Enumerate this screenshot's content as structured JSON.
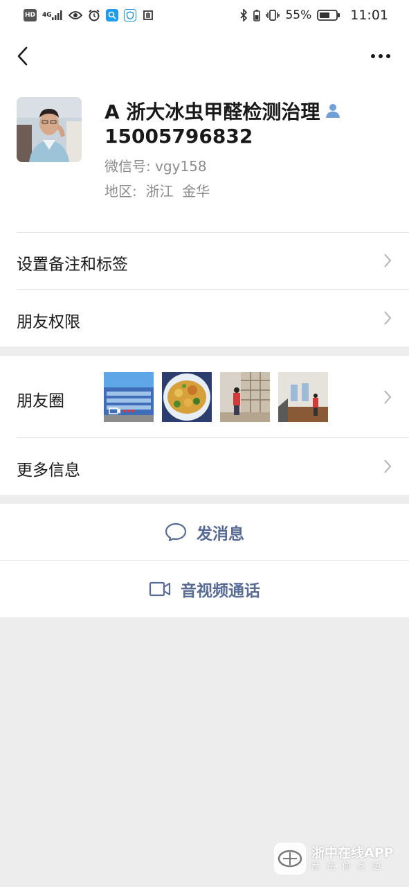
{
  "status_bar": {
    "hd": "HD",
    "signal": "4G",
    "battery_percent": "55%",
    "time": "11:01"
  },
  "profile": {
    "nickname": "A 浙大冰虫甲醛检测治理",
    "name": "15005796832",
    "wechat_id": "微信号: vgy158",
    "region": "地区:  浙江  金华"
  },
  "menu": {
    "set_remark": "设置备注和标签",
    "friend_permissions": "朋友权限",
    "moments": "朋友圈",
    "more_info": "更多信息"
  },
  "actions": {
    "send_message": "发消息",
    "video_call": "音视频通话"
  },
  "watermark": {
    "title": "浙中在线APP",
    "subtitle": "就在你身边"
  },
  "colors": {
    "link_blue": "#576b95",
    "background": "#ededed",
    "chevron": "#b2b2b2"
  }
}
